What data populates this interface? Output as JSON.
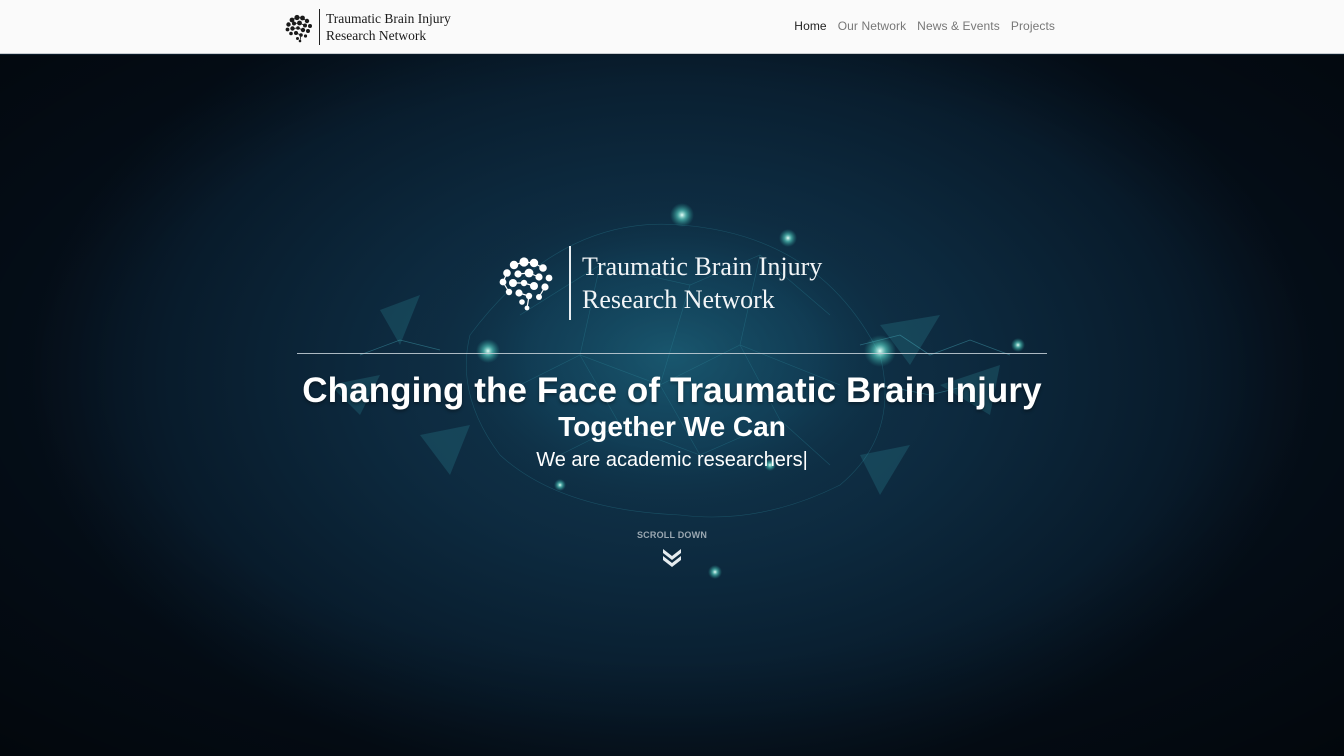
{
  "header": {
    "brand": {
      "line1": "Traumatic Brain Injury",
      "line2": "Research Network",
      "logo_icon": "brain-network-icon"
    },
    "nav": [
      {
        "label": "Home",
        "active": true
      },
      {
        "label": "Our Network",
        "active": false
      },
      {
        "label": "News & Events",
        "active": false
      },
      {
        "label": "Projects",
        "active": false
      }
    ]
  },
  "hero": {
    "logo": {
      "line1": "Traumatic Brain Injury",
      "line2": "Research Network",
      "icon": "brain-network-icon"
    },
    "title": "Changing the Face of Traumatic Brain Injury",
    "subtitle": "Together We Can",
    "typed_text": "We are academic researchers|",
    "scroll": {
      "label": "SCROLL DOWN",
      "icon": "double-chevron-down-icon"
    },
    "background_icon": "glowing-brain-network-image"
  },
  "colors": {
    "hero_bg_dark": "#050f1a",
    "hero_bg_glow": "#123a52",
    "nav_bg": "#fafafa",
    "nav_active": "#222222",
    "nav_inactive": "#777777",
    "hero_text": "#ffffff",
    "glow_accent": "#4ad6c8"
  }
}
